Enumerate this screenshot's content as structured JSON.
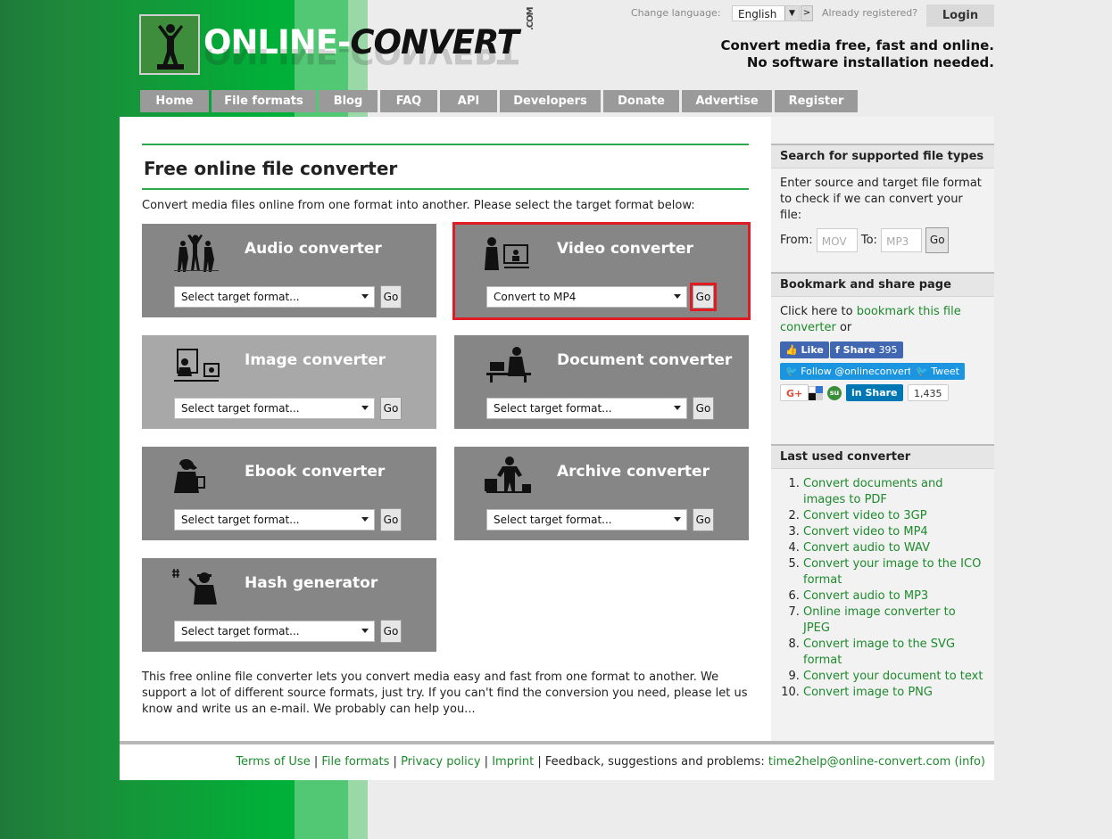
{
  "header": {
    "logo_text_white": "ONLINE-",
    "logo_text_dark": "CONVERT",
    "logo_com": ".COM",
    "change_language_label": "Change language:",
    "language_selected": "English",
    "language_go": ">",
    "already_registered": "Already registered?",
    "login_label": "Login",
    "tagline_line1": "Convert media free, fast and online.",
    "tagline_line2": "No software installation needed."
  },
  "nav": {
    "items": [
      {
        "label": "Home"
      },
      {
        "label": "File formats"
      },
      {
        "label": "Blog"
      },
      {
        "label": "FAQ"
      },
      {
        "label": "API"
      },
      {
        "label": "Developers"
      },
      {
        "label": "Donate"
      },
      {
        "label": "Advertise"
      },
      {
        "label": "Register"
      }
    ]
  },
  "main": {
    "title": "Free online file converter",
    "intro": "Convert media files online from one format into another. Please select the target format below:",
    "converters": [
      {
        "title": "Audio converter",
        "select": "Select target format...",
        "go": "Go",
        "icon": "dancers-icon"
      },
      {
        "title": "Video converter",
        "select": "Convert to MP4",
        "go": "Go",
        "icon": "video-viewer-icon"
      },
      {
        "title": "Image converter",
        "select": "Select target format...",
        "go": "Go",
        "icon": "picture-viewer-icon"
      },
      {
        "title": "Document converter",
        "select": "Select target format...",
        "go": "Go",
        "icon": "office-worker-icon"
      },
      {
        "title": "Ebook converter",
        "select": "Select target format...",
        "go": "Go",
        "icon": "ebook-reader-icon"
      },
      {
        "title": "Archive converter",
        "select": "Select target format...",
        "go": "Go",
        "icon": "archive-person-icon"
      },
      {
        "title": "Hash generator",
        "select": "Select target format...",
        "go": "Go",
        "icon": "hash-person-icon"
      }
    ],
    "bottom_text": "This free online file converter lets you convert media easy and fast from one format to another. We support a lot of different source formats, just try. If you can't find the conversion you need, please let us know and write us an e-mail. We probably can help you..."
  },
  "sidebar": {
    "search": {
      "heading": "Search for supported file types",
      "text": "Enter source and target file format to check if we can convert your file:",
      "from_label": "From:",
      "from_placeholder": "MOV",
      "to_label": "To:",
      "to_placeholder": "MP3",
      "go": "Go"
    },
    "bookmark": {
      "heading": "Bookmark and share page",
      "text_prefix": "Click here to ",
      "link": "bookmark this file converter",
      "text_suffix": " or",
      "like": "Like",
      "share": "Share",
      "share_count": "395",
      "follow": "Follow @onlineconvert",
      "tweet": "Tweet",
      "gplus": "G+",
      "li_share": "Share",
      "li_count": "1,435"
    },
    "last_used": {
      "heading": "Last used converter",
      "items": [
        "Convert documents and images to PDF",
        "Convert video to 3GP",
        "Convert video to MP4",
        "Convert audio to WAV",
        "Convert your image to the ICO format",
        "Convert audio to MP3",
        "Online image converter to JPEG",
        "Convert image to the SVG format",
        "Convert your document to text",
        "Convert image to PNG"
      ]
    }
  },
  "footer": {
    "terms": "Terms of Use",
    "file_formats": "File formats",
    "privacy": "Privacy policy",
    "imprint": "Imprint",
    "feedback": "Feedback, suggestions and problems:",
    "email": "time2help@online-convert.com",
    "info": "(info)"
  },
  "colors": {
    "accent_green": "#2ea84a",
    "link_green": "#1d8a2c",
    "highlight_red": "#e11b23",
    "card_gray": "#868686"
  }
}
